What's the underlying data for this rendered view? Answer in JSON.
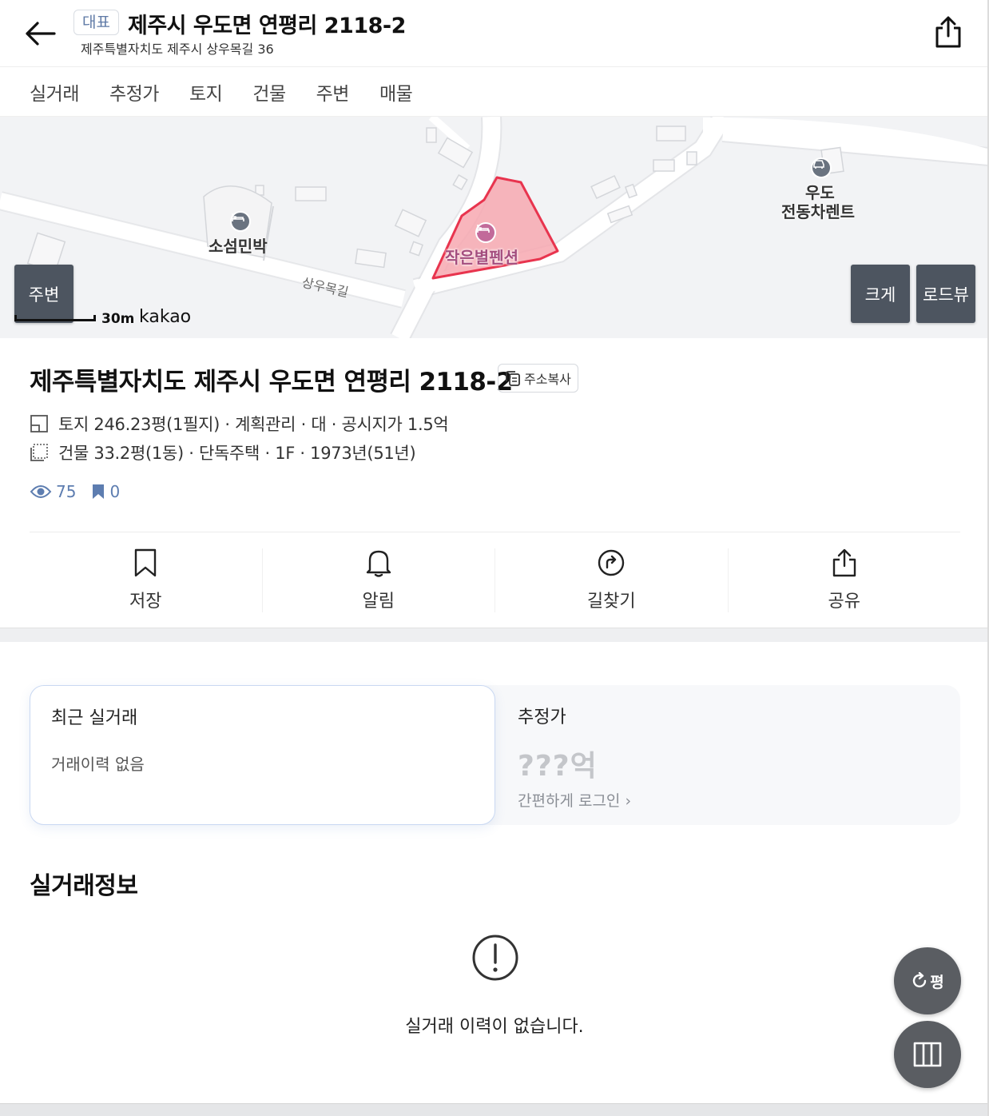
{
  "header": {
    "badge": "대표",
    "title": "제주시 우도면 연평리 2118-2",
    "subtitle": "제주특별자치도 제주시 상우목길 36"
  },
  "tabs": [
    {
      "label": "실거래"
    },
    {
      "label": "추정가"
    },
    {
      "label": "토지"
    },
    {
      "label": "건물"
    },
    {
      "label": "주변"
    },
    {
      "label": "매물"
    }
  ],
  "map": {
    "nearby_button": "주변",
    "large_button": "크게",
    "roadview_button": "로드뷰",
    "scale": "30m",
    "provider": "kakao",
    "road_name": "상우목길",
    "poi": [
      {
        "name": "소섬민박",
        "icon": "lodging-icon"
      },
      {
        "name": "작은별펜션",
        "icon": "lodging-icon"
      },
      {
        "name_line1": "우도",
        "name_line2": "전동차렌트",
        "icon": "car-icon"
      }
    ],
    "parcel_color": "#f7a8b0",
    "parcel_stroke": "#e8344e"
  },
  "property": {
    "full_address": "제주특별자치도 제주시 우도면 연평리 2118-2",
    "copy_label": "주소복사",
    "land": "토지 246.23평(1필지) · 계획관리 · 대 · 공시지가 1.5억",
    "building": "건물 33.2평(1동) · 단독주택 · 1F · 1973년(51년)",
    "views": "75",
    "bookmarks": "0"
  },
  "actions": [
    {
      "label": "저장",
      "icon": "bookmark-icon"
    },
    {
      "label": "알림",
      "icon": "bell-icon"
    },
    {
      "label": "길찾기",
      "icon": "directions-icon"
    },
    {
      "label": "공유",
      "icon": "share-icon"
    }
  ],
  "recent_trade": {
    "title": "최근 실거래",
    "value": "거래이력 없음"
  },
  "estimate": {
    "title": "추정가",
    "value": "???억",
    "login": "간편하게 로그인 ›"
  },
  "trade_info": {
    "title": "실거래정보",
    "empty": "실거래 이력이 없습니다."
  },
  "fab": {
    "unit_toggle": "평"
  },
  "colors": {
    "accent_blue": "#5d7db0",
    "dark_button": "#4d5560",
    "fab": "#5a5d62"
  }
}
